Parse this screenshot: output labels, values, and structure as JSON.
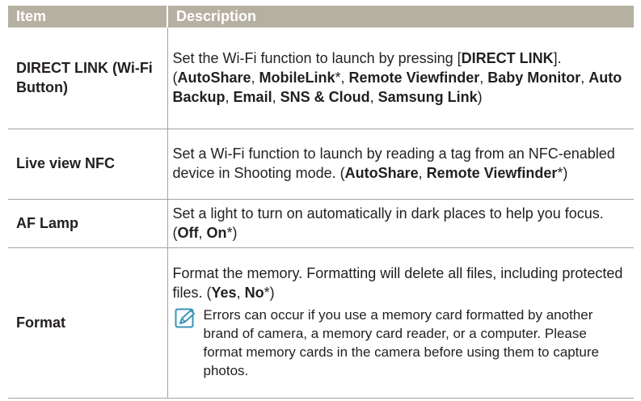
{
  "table": {
    "headers": {
      "item": "Item",
      "description": "Description"
    },
    "rows": [
      {
        "item": "DIRECT LINK (Wi-Fi Button)",
        "desc": [
          {
            "t": "Set the Wi-Fi function to launch by pressing ["
          },
          {
            "t": "DIRECT LINK",
            "b": true
          },
          {
            "t": "]. ("
          },
          {
            "t": "AutoShare",
            "b": true
          },
          {
            "t": ", "
          },
          {
            "t": "MobileLink",
            "b": true
          },
          {
            "t": "*, "
          },
          {
            "t": "Remote Viewfinder",
            "b": true
          },
          {
            "t": ", "
          },
          {
            "t": "Baby Monitor",
            "b": true
          },
          {
            "t": ", "
          },
          {
            "t": "Auto Backup",
            "b": true
          },
          {
            "t": ", "
          },
          {
            "t": "Email",
            "b": true
          },
          {
            "t": ", "
          },
          {
            "t": "SNS & Cloud",
            "b": true
          },
          {
            "t": ", "
          },
          {
            "t": "Samsung Link",
            "b": true
          },
          {
            "t": ")"
          }
        ]
      },
      {
        "item": "Live view NFC",
        "desc": [
          {
            "t": "Set a Wi-Fi function to launch by reading a tag from an NFC-enabled device in Shooting mode. ("
          },
          {
            "t": "AutoShare",
            "b": true
          },
          {
            "t": ", "
          },
          {
            "t": "Remote Viewfinder",
            "b": true
          },
          {
            "t": "*)"
          }
        ]
      },
      {
        "item": "AF Lamp",
        "desc": [
          {
            "t": "Set a light to turn on automatically in dark places to help you focus. ("
          },
          {
            "t": "Off",
            "b": true
          },
          {
            "t": ", "
          },
          {
            "t": "On",
            "b": true
          },
          {
            "t": "*)"
          }
        ]
      },
      {
        "item": "Format",
        "desc": [
          {
            "t": "Format the memory. Formatting will delete all files, including protected files. ("
          },
          {
            "t": "Yes",
            "b": true
          },
          {
            "t": ", "
          },
          {
            "t": "No",
            "b": true
          },
          {
            "t": "*)"
          }
        ],
        "note": "Errors can occur if you use a memory card formatted by another brand of camera, a memory card reader, or a computer. Please format memory cards in the camera before using them to capture photos.",
        "note_icon": "note-pencil-icon"
      }
    ]
  },
  "colors": {
    "header_bg": "#b5b0a1",
    "header_text": "#ffffff",
    "rule": "#a7a29a",
    "text": "#231f20",
    "icon": "#3a95b8"
  }
}
